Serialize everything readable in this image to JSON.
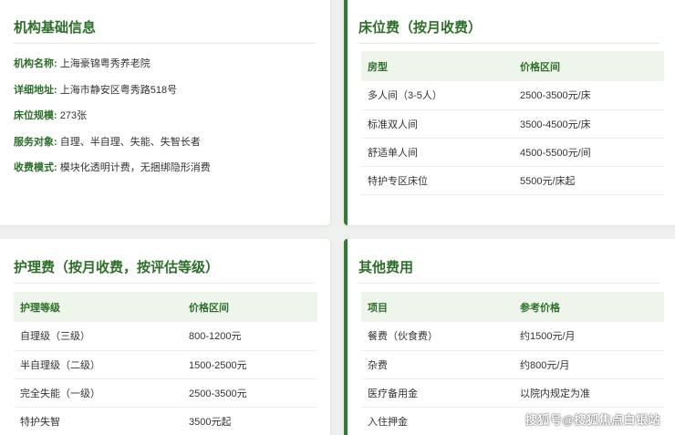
{
  "basic_info": {
    "title": "机构基础信息",
    "rows": [
      {
        "label": "机构名称:",
        "value": "上海豪锦粤秀养老院"
      },
      {
        "label": "详细地址:",
        "value": "上海市静安区粤秀路518号"
      },
      {
        "label": "床位规模:",
        "value": "273张"
      },
      {
        "label": "服务对象:",
        "value": "自理、半自理、失能、失智长者"
      },
      {
        "label": "收费模式:",
        "value": "模块化透明计费，无捆绑隐形消费"
      }
    ]
  },
  "bed_fee": {
    "title": "床位费（按月收费）",
    "headers": [
      "房型",
      "价格区间"
    ],
    "rows": [
      [
        "多人间（3-5人）",
        "2500-3500元/床"
      ],
      [
        "标准双人间",
        "3500-4500元/床"
      ],
      [
        "舒适单人间",
        "4500-5500元/间"
      ],
      [
        "特护专区床位",
        "5500元/床起"
      ]
    ]
  },
  "care_fee": {
    "title": "护理费（按月收费，按评估等级）",
    "headers": [
      "护理等级",
      "价格区间"
    ],
    "rows": [
      [
        "自理级（三级）",
        "800-1200元"
      ],
      [
        "半自理级（二级）",
        "1500-2500元"
      ],
      [
        "完全失能（一级）",
        "2500-3500元"
      ],
      [
        "特护失智",
        "3500元起"
      ]
    ]
  },
  "other_fee": {
    "title": "其他费用",
    "headers": [
      "项目",
      "参考价格"
    ],
    "rows": [
      [
        "餐费（伙食费）",
        "约1500元/月"
      ],
      [
        "杂费",
        "约800元/月"
      ],
      [
        "医疗备用金",
        "以院内规定为准"
      ],
      [
        "入住押金",
        ""
      ]
    ]
  },
  "watermark": "搜狐号@搜狐焦点白银站",
  "colors": {
    "accent": "#2e7d32",
    "heading": "#2e6e2a",
    "header_bg": "#eef6ec"
  }
}
